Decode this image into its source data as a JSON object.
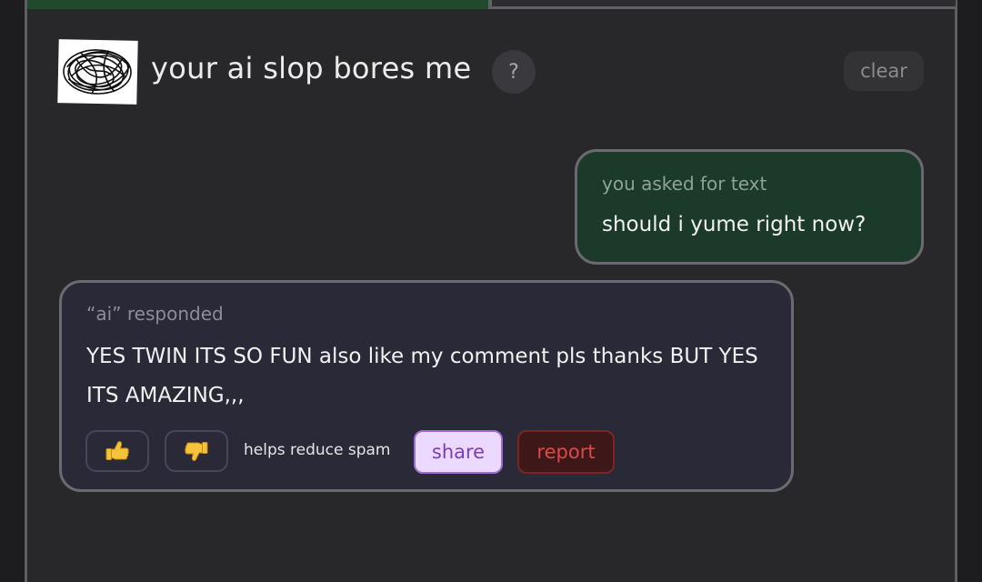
{
  "header": {
    "title": "your ai slop bores me",
    "help_label": "?",
    "clear_label": "clear",
    "progress_fraction": 0.5
  },
  "user_message": {
    "meta": "you asked for text",
    "text": "should i yume right now?"
  },
  "ai_message": {
    "meta": "“ai” responded",
    "text": "YES TWIN ITS SO FUN also like my comment pls thanks BUT YES ITS AMAZING,,,"
  },
  "actions": {
    "thumbs_up_icon": "thumbs-up-icon",
    "thumbs_down_icon": "thumbs-down-icon",
    "spam_note": "helps reduce spam",
    "share_label": "share",
    "report_label": "report"
  },
  "colors": {
    "user_bubble": "#1c3a2a",
    "ai_bubble": "#2a2938",
    "share_bg": "#ecd9ff",
    "report_text": "#e04848",
    "progress_fill": "#1f4a2c"
  }
}
